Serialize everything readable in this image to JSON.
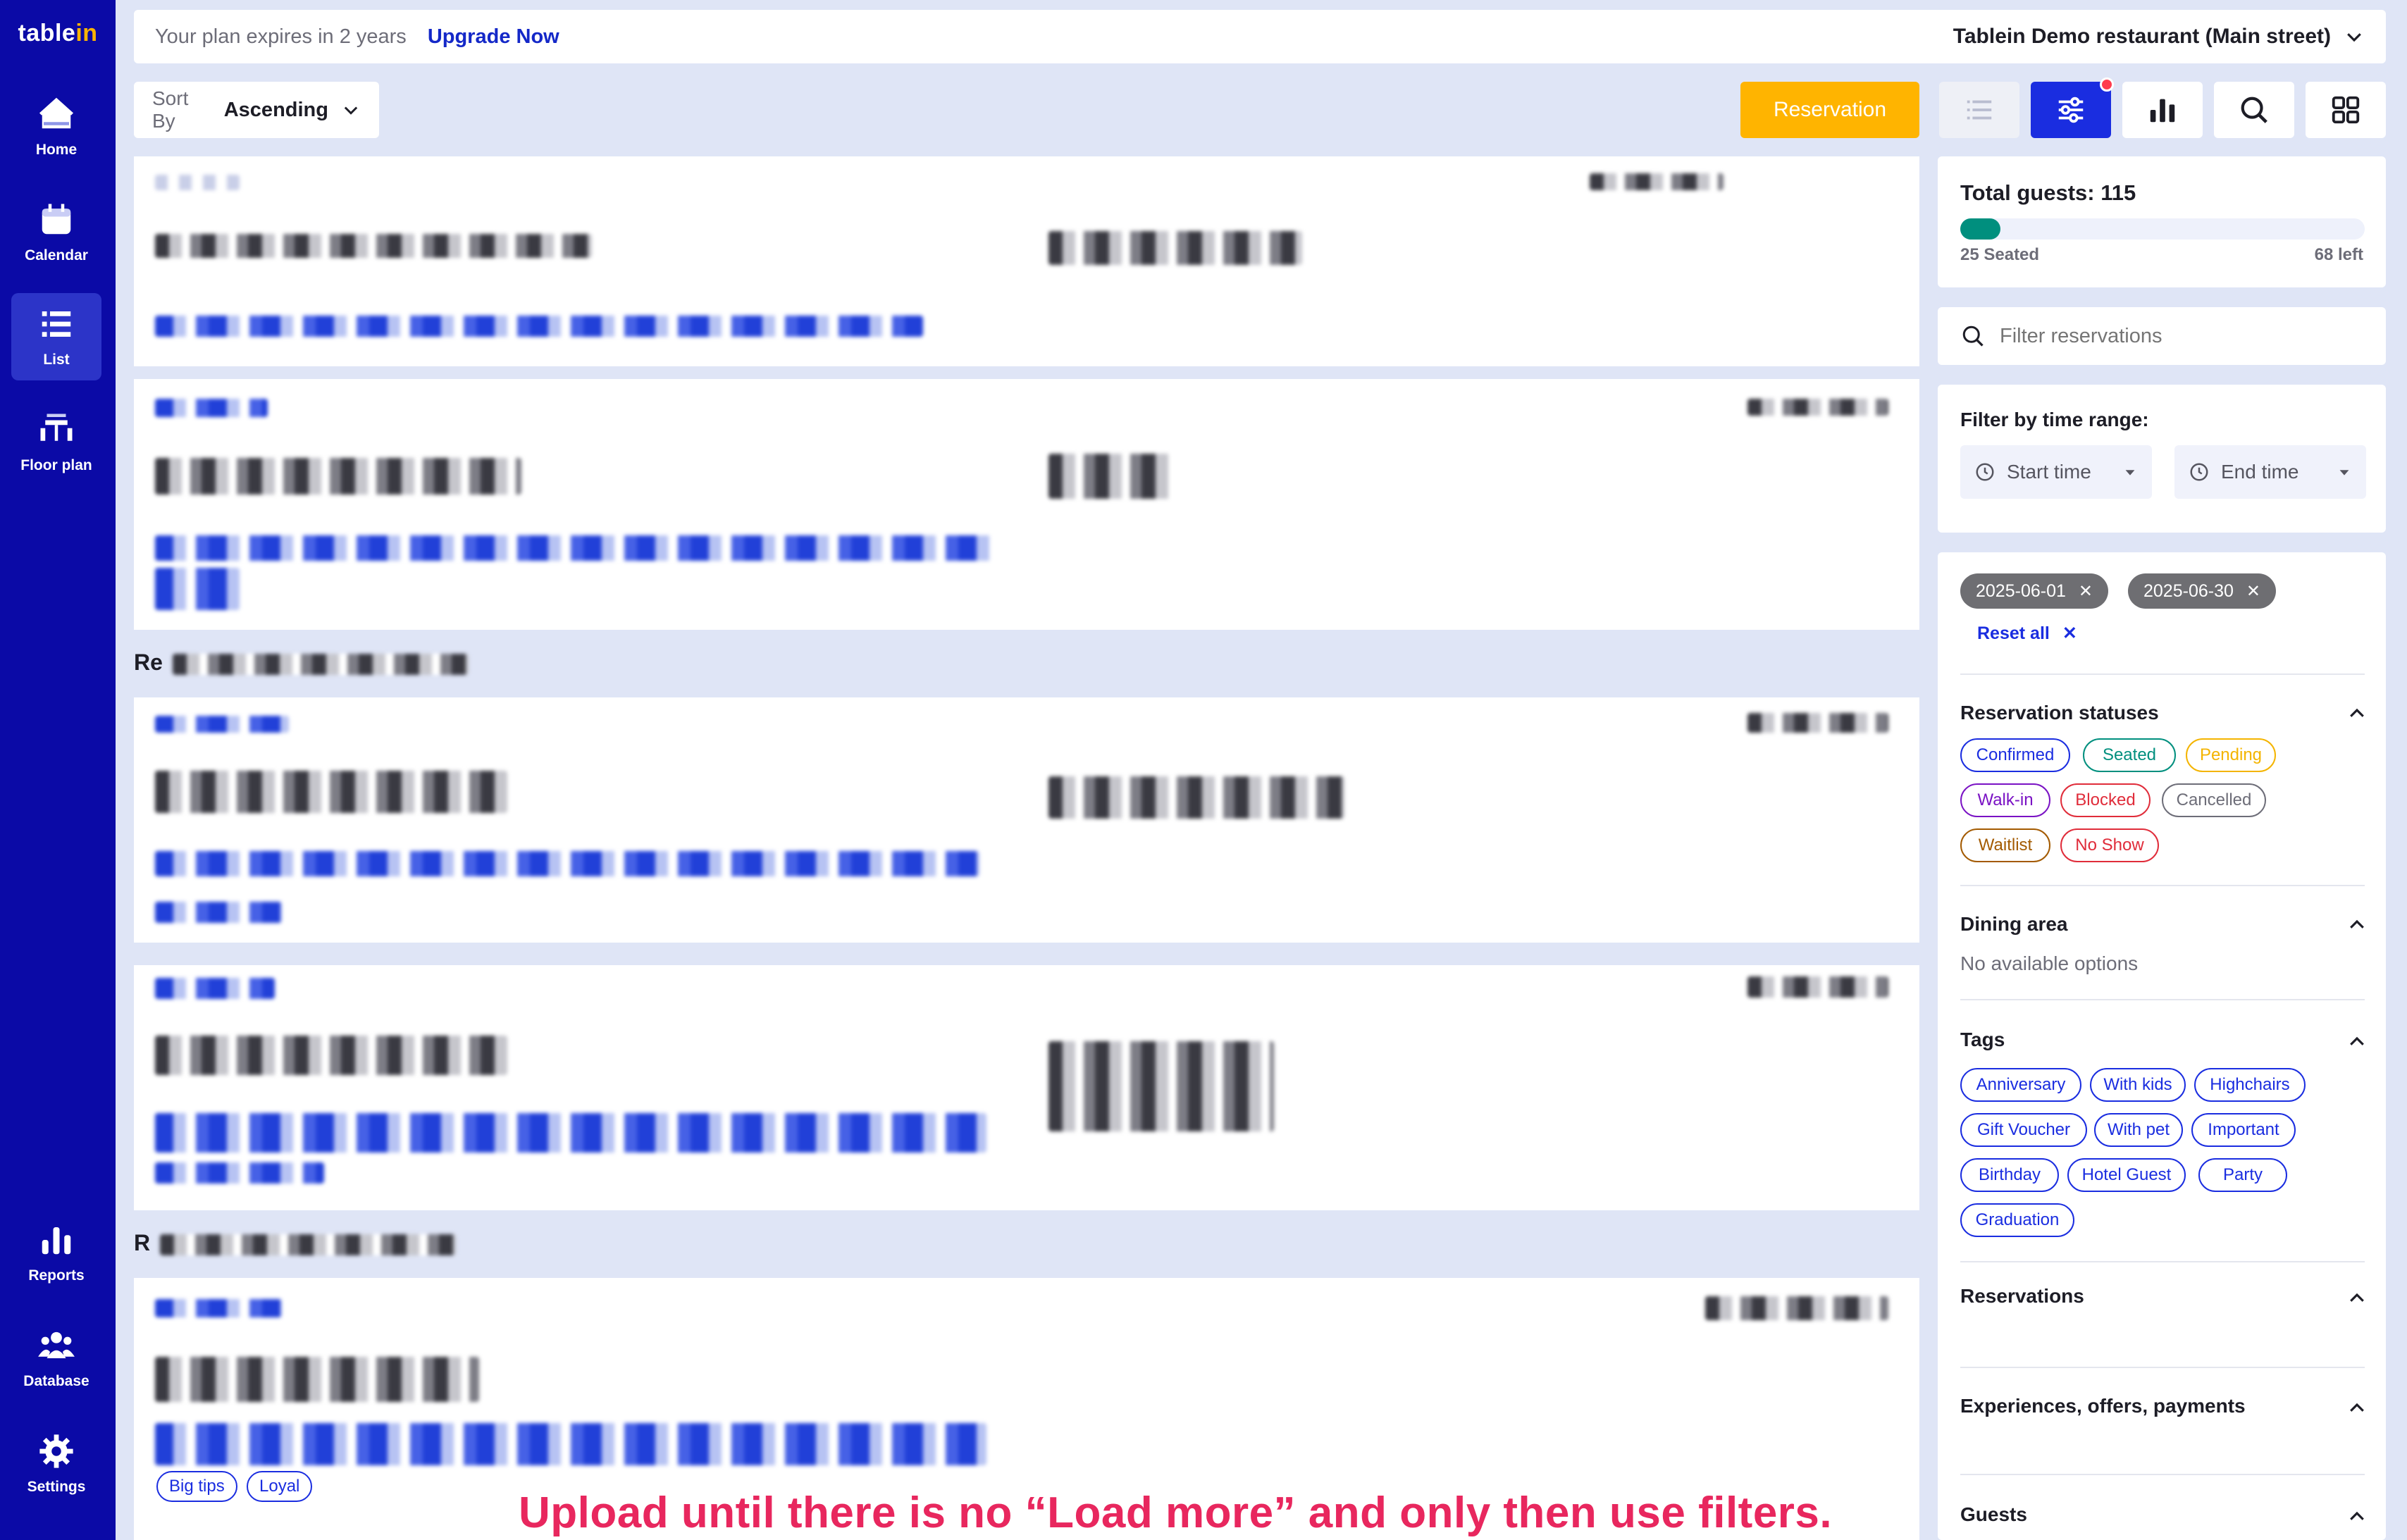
{
  "app": {
    "brand_prefix": "table",
    "brand_suffix": "in"
  },
  "nav": {
    "home": "Home",
    "calendar": "Calendar",
    "list": "List",
    "floor_plan": "Floor plan",
    "reports": "Reports",
    "database": "Database",
    "settings": "Settings"
  },
  "topbar": {
    "plan_notice": "Your plan expires in 2 years",
    "upgrade_link": "Upgrade Now",
    "restaurant": "Tablein Demo restaurant (Main street)"
  },
  "toolbar": {
    "sort_label": "Sort By",
    "sort_value": "Ascending",
    "reservation_button": "Reservation"
  },
  "list": {
    "group_prefix_1": "Re",
    "group_prefix_2": "R",
    "card_tags": [
      "Big tips",
      "Loyal"
    ]
  },
  "summary": {
    "total_label": "Total guests: 115",
    "seated_label": "25 Seated",
    "left_label": "68 left",
    "seated_fraction": 0.1
  },
  "filters": {
    "search_placeholder": "Filter reservations",
    "time_range_label": "Filter by time range:",
    "start_time": "Start time",
    "end_time": "End time",
    "date_from": "2025-06-01",
    "date_to": "2025-06-30",
    "reset_all": "Reset all",
    "statuses_title": "Reservation statuses",
    "statuses": [
      {
        "label": "Confirmed",
        "color": "#1a2de0"
      },
      {
        "label": "Seated",
        "color": "#008f7e"
      },
      {
        "label": "Pending",
        "color": "#f4b400"
      },
      {
        "label": "Walk-in",
        "color": "#7a12c4"
      },
      {
        "label": "Blocked",
        "color": "#e02c3a"
      },
      {
        "label": "Cancelled",
        "color": "#6d6d78"
      },
      {
        "label": "Waitlist",
        "color": "#a35a00"
      },
      {
        "label": "No Show",
        "color": "#e02c3a"
      }
    ],
    "dining_title": "Dining area",
    "dining_empty": "No available options",
    "tags_title": "Tags",
    "tags": [
      "Anniversary",
      "With kids",
      "Highchairs",
      "Gift Voucher",
      "With pet",
      "Important",
      "Birthday",
      "Hotel Guest",
      "Party",
      "Graduation"
    ],
    "reservations_title": "Reservations",
    "experiences_title": "Experiences, offers, payments",
    "guests_title": "Guests"
  },
  "annotation": {
    "note": "Upload until there is no “Load more” and only then use filters."
  },
  "colors": {
    "sidebar": "#0b0aa6",
    "accent": "#ffb400",
    "primary": "#1a2de0",
    "seated": "#008f7e",
    "annotation": "#e8275e"
  }
}
